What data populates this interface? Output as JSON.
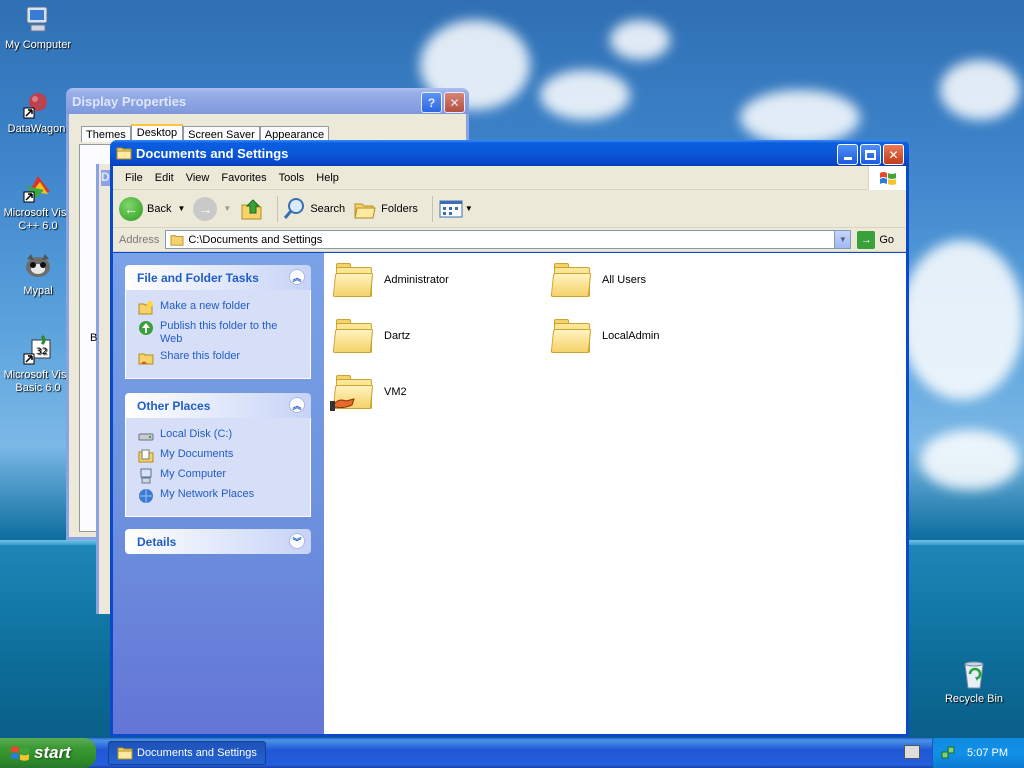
{
  "desktop": {
    "icons": [
      {
        "label": "My Computer",
        "icon": "computer-icon"
      },
      {
        "label": "DataWagon.",
        "icon": "network-shortcut-icon"
      },
      {
        "label": "Microsoft Visual C++ 6.0",
        "label_l1": "Microsoft Visu",
        "label_l2": "C++ 6.0",
        "icon": "visual-cpp-icon"
      },
      {
        "label": "Mypal",
        "icon": "mypal-browser-icon"
      },
      {
        "label": "Microsoft Visual Basic 6.0",
        "label_l1": "Microsoft Visu",
        "label_l2": "Basic 6.0",
        "icon": "visual-basic-icon"
      },
      {
        "label": "Recycle Bin",
        "icon": "recycle-bin-icon"
      }
    ]
  },
  "display_properties": {
    "title": "Display Properties",
    "tabs": [
      "Themes",
      "Desktop",
      "Screen Saver",
      "Appearance"
    ],
    "active_tab": "Desktop",
    "behind_letter_d": "D",
    "behind_letter_b": "B"
  },
  "explorer": {
    "title": "Documents and Settings",
    "menu": [
      "File",
      "Edit",
      "View",
      "Favorites",
      "Tools",
      "Help"
    ],
    "toolbar": {
      "back": "Back",
      "search": "Search",
      "folders": "Folders"
    },
    "address": {
      "label": "Address",
      "value": "C:\\Documents and Settings",
      "go": "Go"
    },
    "tasks": {
      "file_folder": {
        "title": "File and Folder Tasks",
        "links": [
          "Make a new folder",
          "Publish this folder to the Web",
          "Share this folder"
        ]
      },
      "other_places": {
        "title": "Other Places",
        "links": [
          "Local Disk (C:)",
          "My Documents",
          "My Computer",
          "My Network Places"
        ]
      },
      "details": {
        "title": "Details"
      }
    },
    "folders": [
      {
        "name": "Administrator"
      },
      {
        "name": "All Users"
      },
      {
        "name": "Dartz"
      },
      {
        "name": "LocalAdmin"
      },
      {
        "name": "VM2",
        "shared": true
      }
    ]
  },
  "taskbar": {
    "start": "start",
    "task": "Documents and Settings",
    "clock": "5:07 PM"
  }
}
